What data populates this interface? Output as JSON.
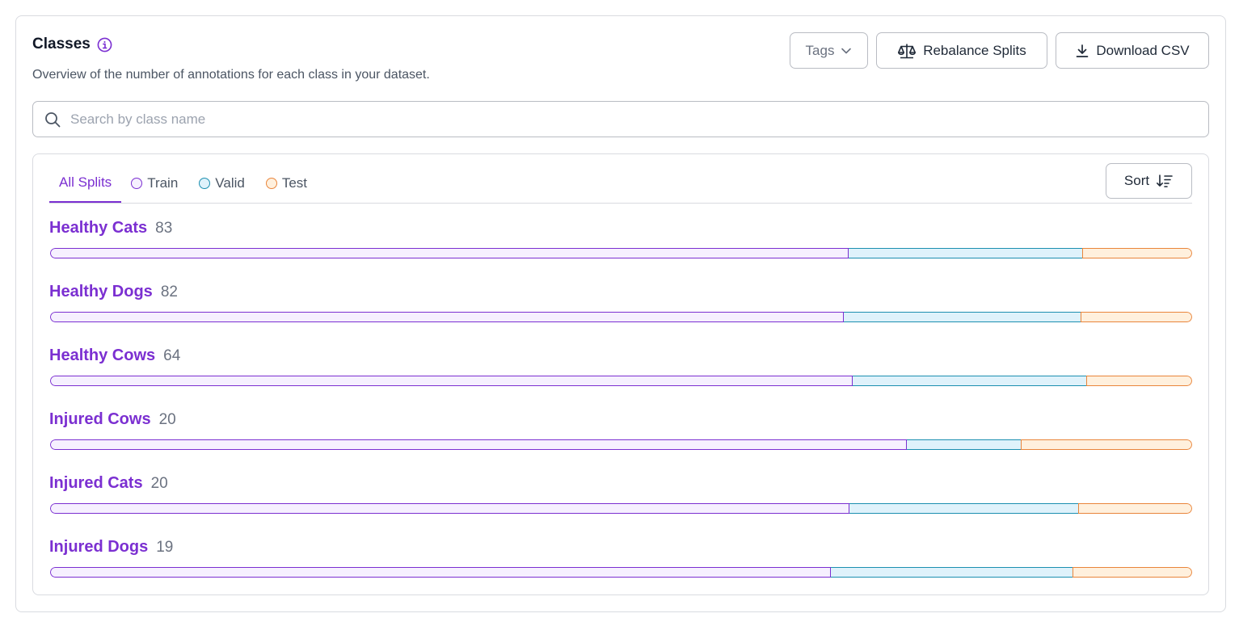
{
  "header": {
    "title": "Classes",
    "subtitle": "Overview of the number of annotations for each class in your dataset.",
    "info_icon": "info-icon"
  },
  "actions": {
    "tags_label": "Tags",
    "rebalance_label": "Rebalance Splits",
    "download_label": "Download CSV"
  },
  "search": {
    "placeholder": "Search by class name",
    "value": ""
  },
  "tabs": [
    {
      "label": "All Splits",
      "active": true
    },
    {
      "label": "Train",
      "dot_color": "#7b2fd1"
    },
    {
      "label": "Valid",
      "dot_color": "#1c8fb0"
    },
    {
      "label": "Test",
      "dot_color": "#e9853b"
    }
  ],
  "sort_label": "Sort",
  "colors": {
    "accent": "#7b2fd1",
    "train": "#7b2fd1",
    "valid": "#1c8fb0",
    "test": "#e9853b"
  },
  "classes": [
    {
      "name": "Healthy Cats",
      "count": "83",
      "split": {
        "train": 0.699,
        "valid": 0.205,
        "test": 0.096
      }
    },
    {
      "name": "Healthy Dogs",
      "count": "82",
      "split": {
        "train": 0.695,
        "valid": 0.207,
        "test": 0.098
      }
    },
    {
      "name": "Healthy Cows",
      "count": "64",
      "split": {
        "train": 0.703,
        "valid": 0.204,
        "test": 0.093
      }
    },
    {
      "name": "Injured Cows",
      "count": "20",
      "split": {
        "train": 0.75,
        "valid": 0.1,
        "test": 0.15
      }
    },
    {
      "name": "Injured Cats",
      "count": "20",
      "split": {
        "train": 0.7,
        "valid": 0.2,
        "test": 0.1
      }
    },
    {
      "name": "Injured Dogs",
      "count": "19",
      "split": {
        "train": 0.684,
        "valid": 0.211,
        "test": 0.105
      }
    }
  ]
}
